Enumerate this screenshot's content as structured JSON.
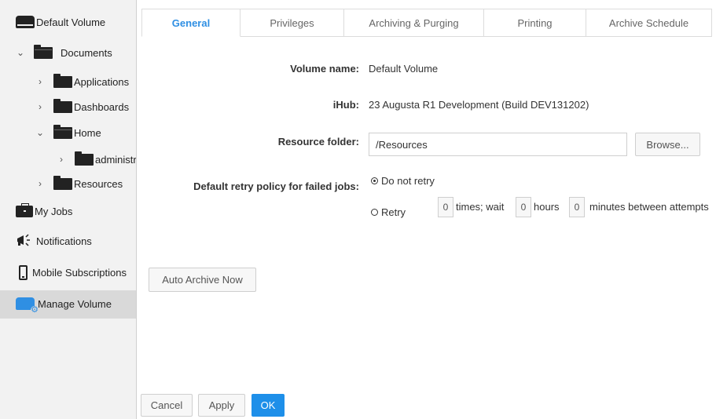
{
  "sidebar": {
    "default_volume": "Default Volume",
    "documents": "Documents",
    "applications": "Applications",
    "dashboards": "Dashboards",
    "home": "Home",
    "administrator": "administrator",
    "resources": "Resources",
    "my_jobs": "My Jobs",
    "notifications": "Notifications",
    "mobile_subscriptions": "Mobile Subscriptions",
    "manage_volume": "Manage Volume"
  },
  "tabs": [
    "General",
    "Privileges",
    "Archiving & Purging",
    "Printing",
    "Archive Schedule"
  ],
  "general": {
    "volume_name_label": "Volume name:",
    "volume_name_value": "Default Volume",
    "ihub_label": "iHub:",
    "ihub_value": "23 Augusta R1 Development (Build DEV131202)",
    "resource_folder_label": "Resource folder:",
    "resource_folder_value": "/Resources",
    "browse_label": "Browse...",
    "retry_policy_label": "Default retry policy for failed jobs:",
    "do_not_retry_label": "Do not retry",
    "retry_label": "Retry",
    "retry_times": "0",
    "times_wait_text": "times; wait",
    "retry_hours": "0",
    "hours_text": "hours",
    "retry_minutes": "0",
    "minutes_text": "minutes between attempts",
    "auto_archive_label": "Auto Archive Now",
    "selected_retry": "Do not retry"
  },
  "footer": {
    "cancel_label": "Cancel",
    "apply_label": "Apply",
    "ok_label": "OK"
  },
  "colors": {
    "accent": "#2f8fe3",
    "primary_button": "#1e8fe9",
    "sidebar_bg": "#f2f2f2",
    "sidebar_active": "#d9d9d9"
  }
}
